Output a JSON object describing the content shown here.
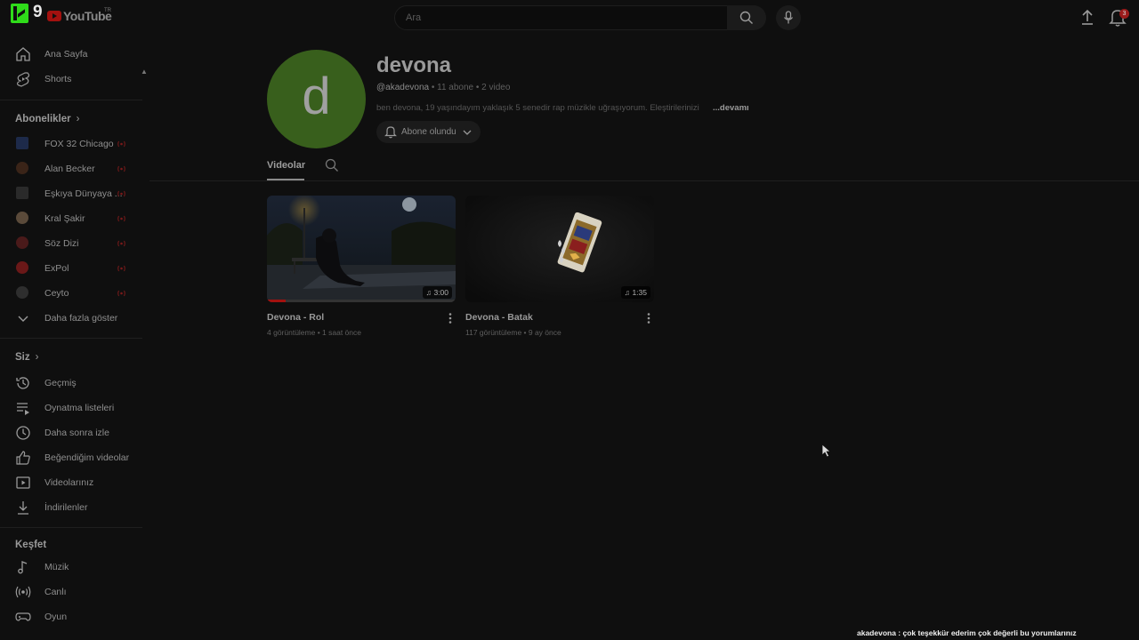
{
  "logo": {
    "k_number": "9",
    "youtube": "YouTube",
    "tm": "TR"
  },
  "search": {
    "placeholder": "Ara"
  },
  "notifications": {
    "count": "3"
  },
  "sidebar": {
    "main_items": [
      {
        "label": "Ana Sayfa",
        "icon": "home-icon"
      },
      {
        "label": "Shorts",
        "icon": "shorts-icon"
      }
    ],
    "subscriptions_heading": "Abonelikler",
    "subscriptions": [
      {
        "label": "FOX 32 Chicago",
        "live": true
      },
      {
        "label": "Alan Becker",
        "live": true
      },
      {
        "label": "Eşkıya Dünyaya ...",
        "live": true
      },
      {
        "label": "Kral Şakir",
        "live": true
      },
      {
        "label": "Söz Dizi",
        "live": true
      },
      {
        "label": "ExPol",
        "live": true
      },
      {
        "label": "Ceyto",
        "live": true
      }
    ],
    "show_more": "Daha fazla göster",
    "you_heading": "Siz",
    "you_items": [
      {
        "label": "Geçmiş",
        "icon": "history-icon"
      },
      {
        "label": "Oynatma listeleri",
        "icon": "playlists-icon"
      },
      {
        "label": "Daha sonra izle",
        "icon": "watch-later-icon"
      },
      {
        "label": "Beğendiğim videolar",
        "icon": "liked-icon"
      },
      {
        "label": "Videolarınız",
        "icon": "your-videos-icon"
      },
      {
        "label": "İndirilenler",
        "icon": "downloads-icon"
      }
    ],
    "explore_heading": "Keşfet",
    "explore_items": [
      {
        "label": "Müzik",
        "icon": "music-icon"
      },
      {
        "label": "Canlı",
        "icon": "live-icon"
      },
      {
        "label": "Oyun",
        "icon": "gaming-icon"
      }
    ]
  },
  "channel": {
    "avatar_letter": "d",
    "avatar_color": "#385f1c",
    "name": "devona",
    "handle": "@akadevona",
    "stats": " • 11 abone • 2 video",
    "description": "ben devona, 19 yaşındayım yaklaşık 5 senedir rap müzikle uğraşıyorum. Eleştirilerinizi",
    "more": "...devamı",
    "subscribe_label": "Abone olundu"
  },
  "tabs": {
    "videos": "Videolar"
  },
  "videos": [
    {
      "title": "Devona - Rol",
      "meta": "4 görüntüleme • 1 saat önce",
      "duration": "3:00",
      "progress": 0.1
    },
    {
      "title": "Devona - Batak",
      "meta": "117 görüntüleme • 9 ay önce",
      "duration": "1:35",
      "progress": 0
    }
  ],
  "overlay_comment": "akadevona : çok teşekkür ederim çok değerli bu yorumlarınız",
  "colors": {
    "accent": "#a3110f",
    "k_green": "#2fdc1a",
    "background": "#0f0f0f"
  }
}
